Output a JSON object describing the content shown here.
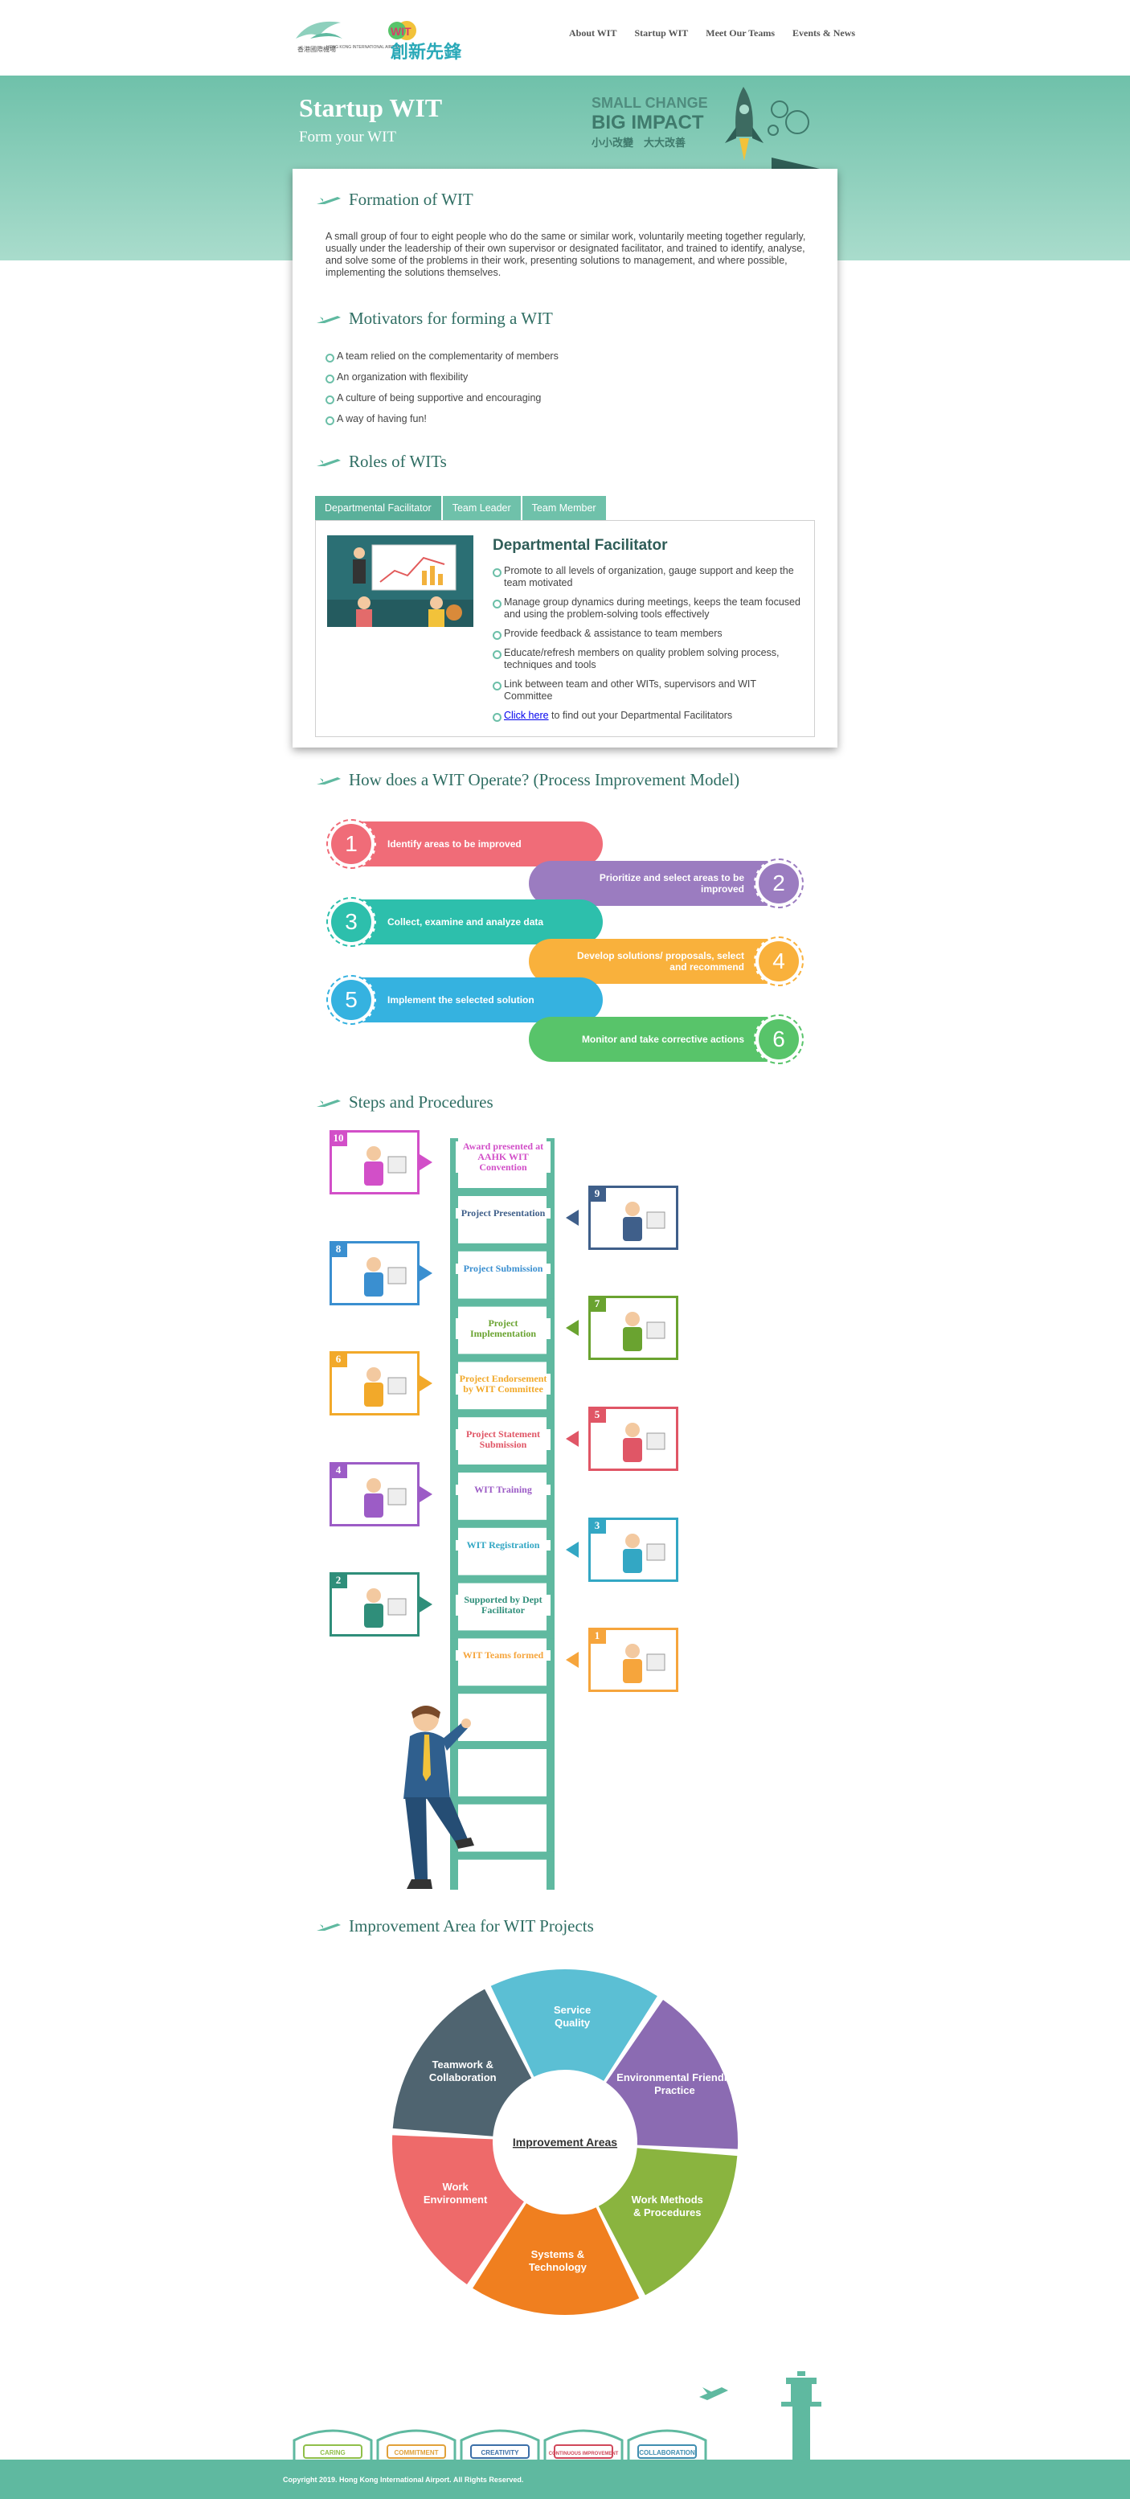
{
  "header": {
    "logo_text_en": "HONG KONG INTERNATIONAL AIRPORT",
    "logo_text_zh": "香港國際機場",
    "wit_logo_zh": "創新先鋒",
    "wit_logo_en": "WIT",
    "nav": [
      "About WIT",
      "Startup WIT",
      "Meet Our Teams",
      "Events & News"
    ]
  },
  "hero": {
    "title": "Startup WIT",
    "subtitle": "Form your WIT",
    "badge_line1": "SMALL CHANGE",
    "badge_line2": "BIG IMPACT",
    "badge_line3": "小小改變　大大改善"
  },
  "formation": {
    "title": "Formation of WIT",
    "text": "A small group of four to eight people who do the same or similar work, voluntarily meeting together regularly, usually under the leadership of their own supervisor or designated facilitator, and trained to identify, analyse, and solve some of the problems in their work, presenting solutions to management, and where possible, implementing the solutions themselves."
  },
  "motivators": {
    "title": "Motivators for forming a WIT",
    "items": [
      "A team relied on the complementarity of members",
      "An organization with flexibility",
      "A culture of being supportive and encouraging",
      "A way of having fun!"
    ]
  },
  "roles": {
    "title": "Roles of WITs",
    "tabs": [
      "Departmental Facilitator",
      "Team Leader",
      "Team Member"
    ],
    "active_title": "Departmental Facilitator",
    "items": [
      "Promote to all levels of organization, gauge support and keep the team motivated",
      "Manage group dynamics during meetings, keeps the team focused and using the problem-solving tools effectively",
      "Provide feedback & assistance to team members",
      "Educate/refresh members on quality problem solving process, techniques and tools",
      "Link between team and other WITs, supervisors and WIT Committee"
    ],
    "link_text": "Click here",
    "link_suffix": " to find out your Departmental Facilitators"
  },
  "process": {
    "title": "How does a WIT Operate? (Process Improvement Model)",
    "steps": [
      {
        "no": "1",
        "label": "Identify areas to be improved",
        "color": "#f06c78"
      },
      {
        "no": "2",
        "label": "Prioritize and select areas to be improved",
        "color": "#9b7cc0"
      },
      {
        "no": "3",
        "label": "Collect, examine and analyze data",
        "color": "#2dbfac"
      },
      {
        "no": "4",
        "label": "Develop solutions/ proposals, select and recommend",
        "color": "#f9b13c"
      },
      {
        "no": "5",
        "label": "Implement the selected solution",
        "color": "#35b2e0"
      },
      {
        "no": "6",
        "label": "Monitor and take corrective actions",
        "color": "#58c46a"
      }
    ]
  },
  "steps_procedures": {
    "title": "Steps and Procedures",
    "rungs": [
      {
        "label": "Award presented at AAHK WIT Convention",
        "color": "#d24fc8"
      },
      {
        "label": "Project Presentation",
        "color": "#3f5f8a"
      },
      {
        "label": "Project Submission",
        "color": "#3a8fd0"
      },
      {
        "label": "Project Implementation",
        "color": "#6aa330"
      },
      {
        "label": "Project Endorsement by WIT Committee",
        "color": "#f2a92a"
      },
      {
        "label": "Project Statement Submission",
        "color": "#e05666"
      },
      {
        "label": "WIT Training",
        "color": "#9c5cc6"
      },
      {
        "label": "WIT Registration",
        "color": "#33a7c4"
      },
      {
        "label": "Supported by Dept Facilitator",
        "color": "#2f8e7a"
      },
      {
        "label": "WIT Teams formed",
        "color": "#f6a53c"
      }
    ],
    "step_numbers": [
      "10",
      "9",
      "8",
      "7",
      "6",
      "5",
      "4",
      "3",
      "2",
      "1"
    ]
  },
  "improvement": {
    "title": "Improvement Area for WIT Projects",
    "center": "Improvement Areas",
    "segments": [
      {
        "label": "Service Quality",
        "color": "#5bbfd4"
      },
      {
        "label": "Environmental Friendly Practice",
        "color": "#8b6bb2"
      },
      {
        "label": "Work Methods & Procedures",
        "color": "#8ab43f"
      },
      {
        "label": "Systems & Technology",
        "color": "#f07f1f"
      },
      {
        "label": "Work Environment",
        "color": "#ee6a6a"
      },
      {
        "label": "Teamwork & Collaboration",
        "color": "#4f6470"
      }
    ]
  },
  "footer": {
    "banners": [
      "CARING",
      "COMMITMENT",
      "CREATIVITY",
      "CONTINUOUS IMPROVEMENT",
      "COLLABORATION"
    ],
    "copyright": "Copyright 2019. Hong Kong International Airport. All Rights Reserved."
  },
  "colors": {
    "teal": "#6fc1aa",
    "dark_teal": "#2f6e63"
  }
}
